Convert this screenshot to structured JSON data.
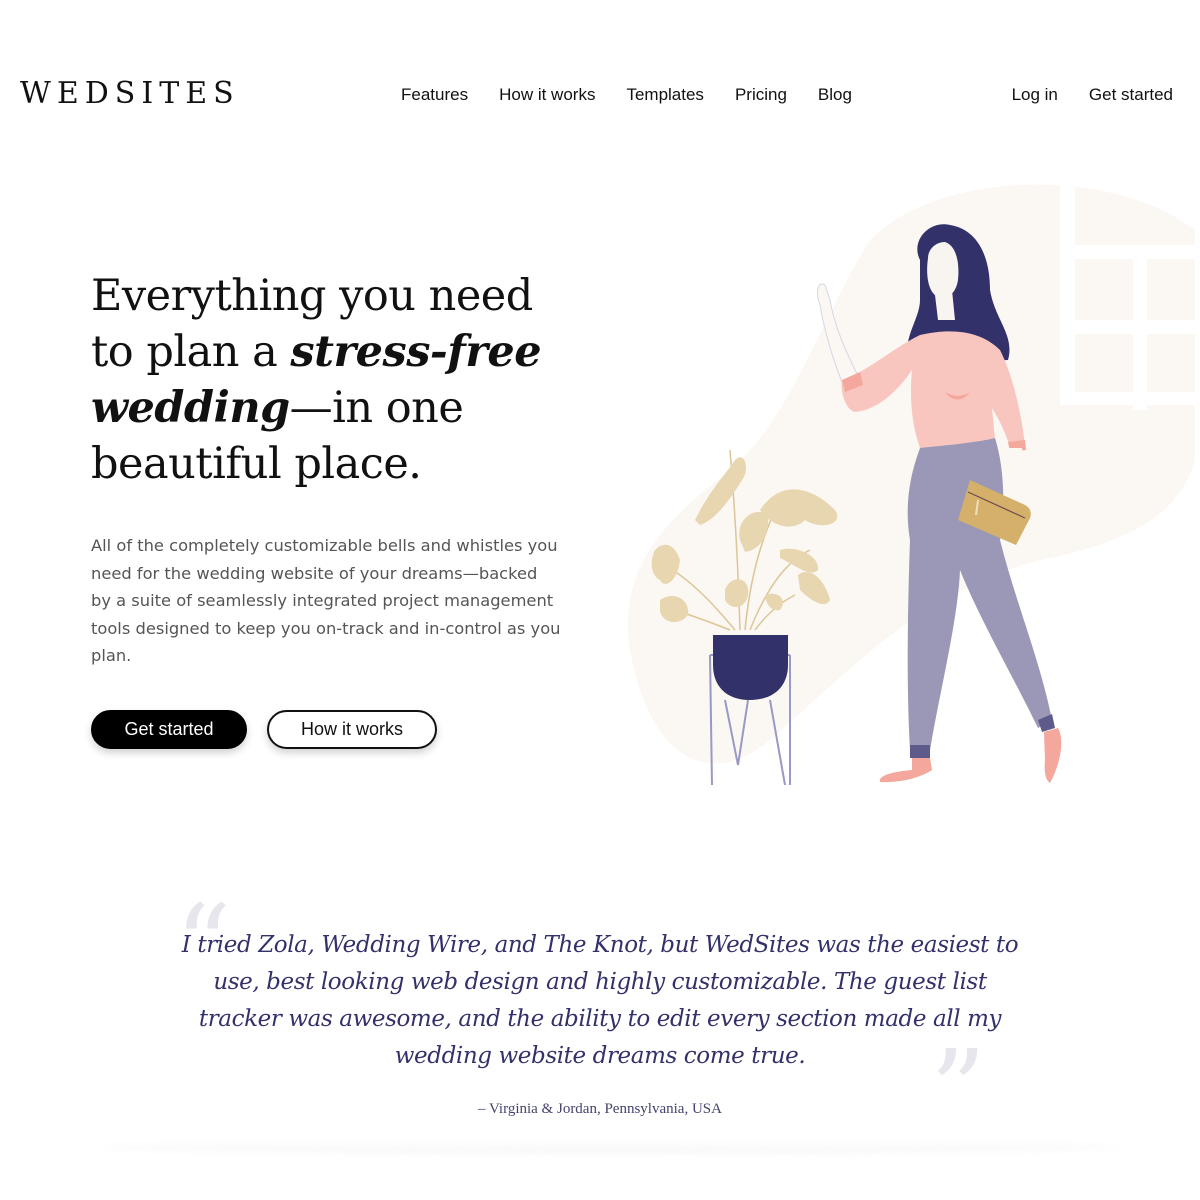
{
  "brand": {
    "logo_text": "WEDSITES",
    "colors": {
      "text": "#111111",
      "navy": "#33316a",
      "blush": "#f9c5bf",
      "sand": "#e8d6b0",
      "cream": "#fbf7f2",
      "lavender": "#9a98b6",
      "gold": "#d4b06a"
    }
  },
  "nav": {
    "items": [
      {
        "label": "Features"
      },
      {
        "label": "How it works"
      },
      {
        "label": "Templates"
      },
      {
        "label": "Pricing"
      },
      {
        "label": "Blog"
      }
    ],
    "login_label": "Log in",
    "get_started_label": "Get started"
  },
  "hero": {
    "title_part1": "Everything you need to plan a ",
    "title_emphasis1": "stress-free wedding",
    "title_part2": "—in one beautiful place.",
    "description": "All of the completely customizable bells and whistles you need for the wedding website of your dreams—backed by a suite of seamlessly integrated project management tools designed to keep you on-track and in-control as you plan.",
    "primary_button": "Get started",
    "secondary_button": "How it works",
    "illustration_icons": [
      "woman-waving-illustration",
      "potted-plant-illustration",
      "window-illustration",
      "book-icon"
    ]
  },
  "testimonial": {
    "open_quote": "“",
    "close_quote": "”",
    "text": "I tried Zola, Wedding Wire, and The Knot, but WedSites was the easiest to use, best looking web design and highly customizable. The guest list tracker was awesome, and the ability to edit every section made all my wedding website dreams come true.",
    "author": "– Virginia & Jordan, Pennsylvania, USA"
  }
}
